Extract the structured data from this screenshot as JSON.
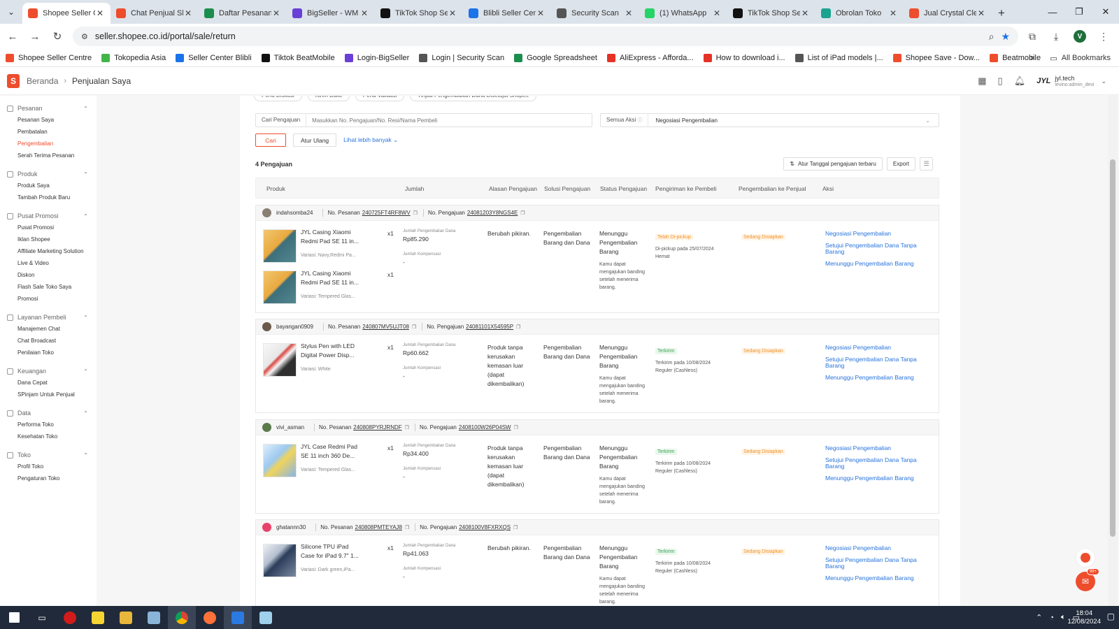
{
  "browser": {
    "tabs": [
      {
        "label": "Shopee Seller C",
        "color": "#ee4d2d",
        "active": true
      },
      {
        "label": "Chat Penjual Sh",
        "color": "#ee4d2d"
      },
      {
        "label": "Daftar Pesanan",
        "color": "#1b8e4d"
      },
      {
        "label": "BigSeller - WM",
        "color": "#6a3fd8"
      },
      {
        "label": "TikTok Shop Se",
        "color": "#111111"
      },
      {
        "label": "Blibli Seller Cen",
        "color": "#1a73e8"
      },
      {
        "label": "Security Scan",
        "color": "#555555"
      },
      {
        "label": "(1) WhatsApp",
        "color": "#25d366"
      },
      {
        "label": "TikTok Shop Se",
        "color": "#111111"
      },
      {
        "label": "Obrolan Toko",
        "color": "#1aa38f"
      },
      {
        "label": "Jual Crystal Cle",
        "color": "#ee4d2d"
      }
    ],
    "url": "seller.shopee.co.id/portal/sale/return",
    "profile_initial": "V",
    "bookmarks": [
      {
        "label": "Shopee Seller Centre",
        "color": "#ee4d2d"
      },
      {
        "label": "Tokopedia Asia",
        "color": "#42b549"
      },
      {
        "label": "Seller Center Blibli",
        "color": "#1a73e8"
      },
      {
        "label": "Tiktok BeatMobile",
        "color": "#111111"
      },
      {
        "label": "Login-BigSeller",
        "color": "#6a3fd8"
      },
      {
        "label": "Login | Security Scan",
        "color": "#555555"
      },
      {
        "label": "Google Spreadsheet",
        "color": "#1b8e4d"
      },
      {
        "label": "AliExpress - Afforda...",
        "color": "#e43225"
      },
      {
        "label": "How to download i...",
        "color": "#e43225"
      },
      {
        "label": "List of iPad models |...",
        "color": "#555555"
      },
      {
        "label": "Shopee Save - Dow...",
        "color": "#ee4d2d"
      },
      {
        "label": "Beatmobile",
        "color": "#ee4d2d"
      }
    ],
    "all_bookmarks": "All Bookmarks"
  },
  "header": {
    "breadcrumb_home": "Beranda",
    "breadcrumb_current": "Penjualan Saya",
    "shop_logo": "JYL",
    "shop_name": "jyl.tech",
    "shop_sub": "levino:admin_devi"
  },
  "sidebar": [
    {
      "title": "Pesanan",
      "items": [
        "Pesanan Saya",
        "Pembatalan",
        "Pengembalian",
        "Serah Terima Pesanan"
      ],
      "active": 2
    },
    {
      "title": "Produk",
      "items": [
        "Produk Saya",
        "Tambah Produk Baru"
      ]
    },
    {
      "title": "Pusat Promosi",
      "items": [
        "Pusat Promosi",
        "Iklan Shopee",
        "Affiliate Marketing Solution",
        "Live & Video",
        "Diskon",
        "Flash Sale Toko Saya",
        "Promosi"
      ]
    },
    {
      "title": "Layanan Pembeli",
      "items": [
        "Manajemen Chat",
        "Chat Broadcast",
        "Penilaian Toko"
      ]
    },
    {
      "title": "Keuangan",
      "items": [
        "Dana Cepat",
        "SPinjam Untuk Penjual"
      ]
    },
    {
      "title": "Data",
      "items": [
        "Performa Toko",
        "Kesehatan Toko"
      ]
    },
    {
      "title": "Toko",
      "items": [
        "Profil Toko",
        "Pengaturan Toko"
      ]
    }
  ],
  "filters": {
    "chips": [
      "Perlu Diskusi",
      "Kirim Bukti",
      "Perlu Validasi",
      "Tinjau Pengembalian Dana Disetujui Shopee"
    ],
    "search_label": "Cari Pengajuan",
    "search_placeholder": "Masukkan No. Pengajuan/No. Resi/Nama Pembeli",
    "action_label": "Semua Aksi",
    "action_value": "Negosiasi Pengembalian",
    "search_button": "Cari",
    "reset_button": "Atur Ulang",
    "more_link": "Lihat lebih banyak"
  },
  "results": {
    "count": "4 Pengajuan",
    "sort_label": "Atur Tanggal pengajuan terbaru",
    "export_label": "Export"
  },
  "table_headers": [
    "Produk",
    "Jumlah",
    "Alasan Pengajuan",
    "Solusi Pengajuan",
    "Status Pengajuan",
    "Pengiriman ke Pembeli",
    "Pengembalian ke Penjual",
    "Aksi"
  ],
  "labels": {
    "order_no": "No. Pesanan",
    "request_no": "No. Pengajuan",
    "refund_amount": "Jumlah Pengembalian Dana",
    "compensation": "Jumlah Kompensasi",
    "compensation_value": "-",
    "status_main": "Menunggu Pengembalian Barang",
    "status_note": "Kamu dapat mengajukan banding setelah menerima barang.",
    "return_status": "Sedang Disiapkan",
    "solution": "Pengembalian Barang dan Dana",
    "actions": [
      "Negosiasi Pengembalian",
      "Setujui Pengembalian Dana Tanpa Barang",
      "Menunggu Pengembalian Barang"
    ]
  },
  "requests": [
    {
      "buyer": "indahsomba24",
      "order_no": "240725FT4RF8WV",
      "request_no": "24081203Y8NGS4E",
      "products": [
        {
          "name": "JYL Casing Xiaomi Redmi Pad SE 11 in...",
          "variant": "Variasi: Navy,Redmi Pa...",
          "qty": "x1"
        },
        {
          "name": "JYL Casing Xiaomi Redmi Pad SE 11 in...",
          "variant": "Variasi: Tempered Glas...",
          "qty": "x1"
        }
      ],
      "refund": "Rp85.290",
      "reason": "Berubah pikiran.",
      "ship_tag": "Telah Di-pickup",
      "ship_line1": "Di-pickup pada 25/07/2024",
      "ship_line2": "Hemat"
    },
    {
      "buyer": "bayangan0909",
      "order_no": "240807MV5UJT08",
      "request_no": "24081101X54595P",
      "products": [
        {
          "name": "Stylus Pen with LED Digital Power Disp...",
          "variant": "Variasi: White",
          "qty": "x1"
        }
      ],
      "refund": "Rp60.662",
      "reason": "Produk tanpa kerusakan kemasan luar (dapat dikembalikan)",
      "ship_tag": "Terkirim",
      "ship_line1": "Terkirim pada 10/08/2024",
      "ship_line2": "Reguler (Cashless)"
    },
    {
      "buyer": "vivi_asman",
      "order_no": "240808PYRJRNDF",
      "request_no": "2408100W26P04SW",
      "products": [
        {
          "name": "JYL Case Redmi Pad SE 11 inch 360 De...",
          "variant": "Variasi: Tempered Glas...",
          "qty": "x1"
        }
      ],
      "refund": "Rp34.400",
      "reason": "Produk tanpa kerusakan kemasan luar (dapat dikembalikan)",
      "ship_tag": "Terkirim",
      "ship_line1": "Terkirim pada 10/08/2024",
      "ship_line2": "Reguler (Cashless)"
    },
    {
      "buyer": "ghatannn30",
      "order_no": "240808PMTEYAJ8",
      "request_no": "2408100V8FXRXQS",
      "products": [
        {
          "name": "Silicone TPU iPad Case for iPad 9.7\" 1...",
          "variant": "Variasi: Dark green,iPa...",
          "qty": "x1"
        }
      ],
      "refund": "Rp41.063",
      "reason": "Berubah pikiran.",
      "ship_tag": "Terkirim",
      "ship_line1": "Terkirim pada 10/08/2024",
      "ship_line2": "Reguler (Cashless)"
    }
  ],
  "chat_badge": "99+",
  "taskbar": {
    "time": "18:04",
    "date": "12/08/2024"
  }
}
